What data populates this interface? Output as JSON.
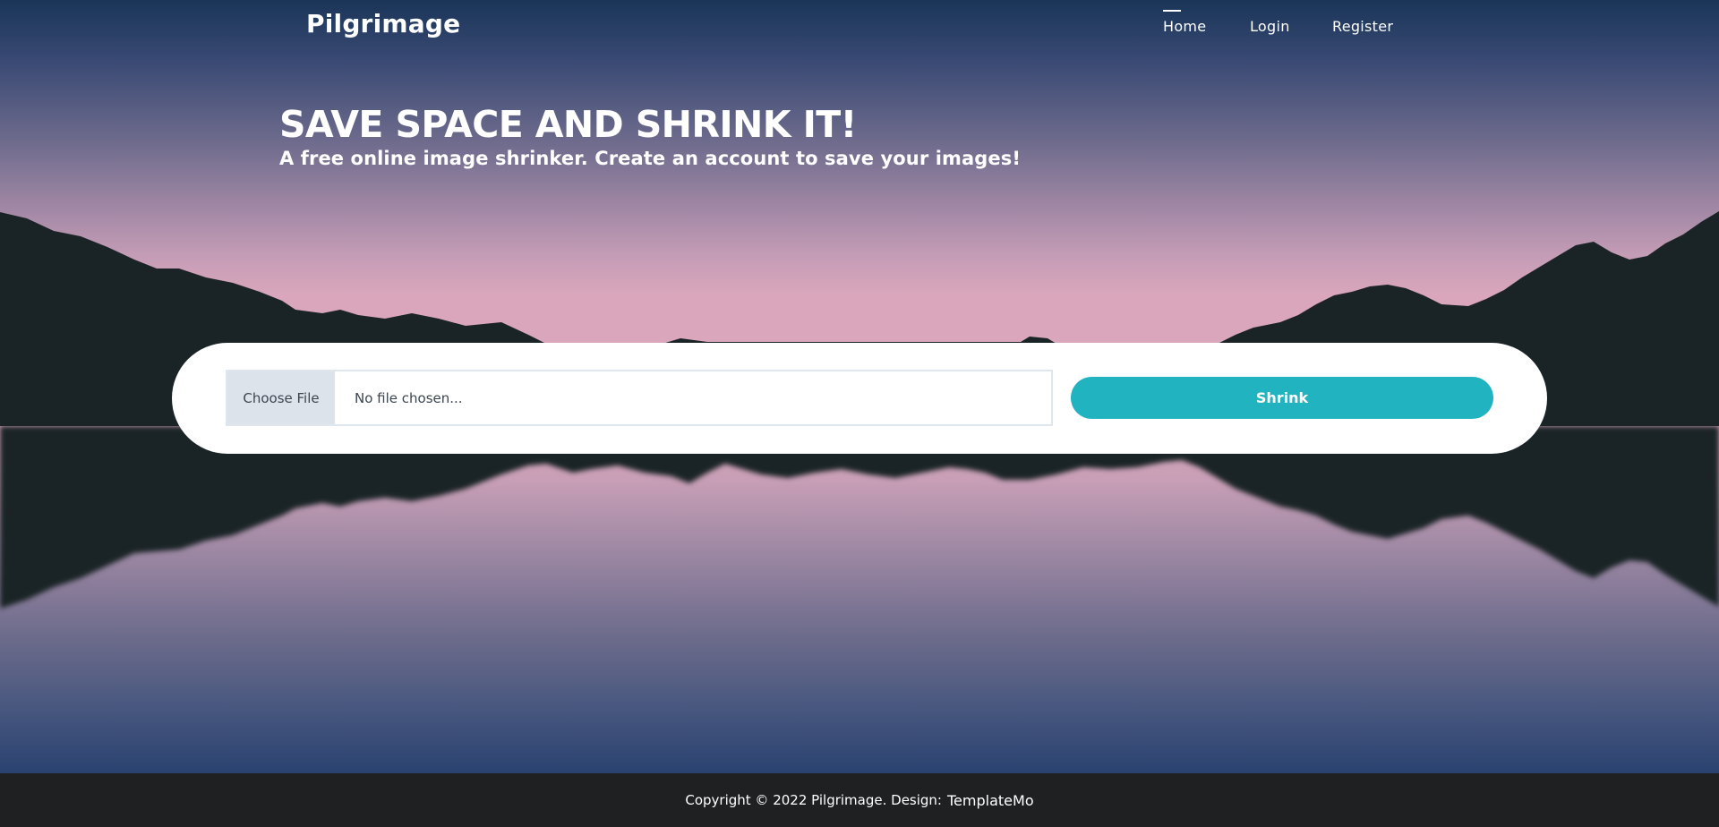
{
  "navbar": {
    "brand": "Pilgrimage",
    "items": [
      {
        "label": "Home",
        "active": true
      },
      {
        "label": "Login",
        "active": false
      },
      {
        "label": "Register",
        "active": false
      }
    ]
  },
  "hero": {
    "title": "SAVE SPACE AND SHRINK IT!",
    "subtitle": "A free online image shrinker. Create an account to save your images!"
  },
  "upload": {
    "choose_file_label": "Choose File",
    "file_status": "No file chosen...",
    "submit_label": "Shrink"
  },
  "footer": {
    "copyright_text": "Copyright © 2022 Pilgrimage. Design:",
    "design_link": "TemplateMo"
  },
  "colors": {
    "accent": "#22b3c1",
    "footer_bg": "#1f2022",
    "mountains": "#1a2426",
    "sky_top": "#1a3558",
    "sky_horizon": "#dba6bb"
  }
}
